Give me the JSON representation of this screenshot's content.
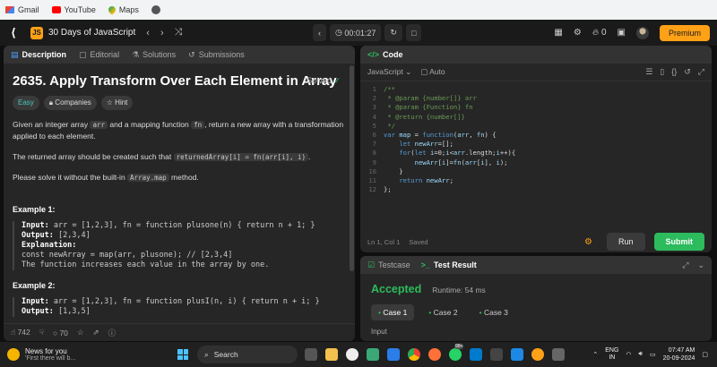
{
  "bookmarks": [
    {
      "label": "Gmail",
      "icon": "gmail-icon"
    },
    {
      "label": "YouTube",
      "icon": "youtube-icon"
    },
    {
      "label": "Maps",
      "icon": "maps-icon"
    }
  ],
  "nav": {
    "study_plan_title": "30 Days of JavaScript",
    "timer": "00:01:27",
    "streak_count": "0",
    "premium_label": "Premium"
  },
  "left_tabs": [
    {
      "label": "Description",
      "active": true
    },
    {
      "label": "Editorial",
      "active": false
    },
    {
      "label": "Solutions",
      "active": false
    },
    {
      "label": "Submissions",
      "active": false
    }
  ],
  "problem": {
    "title": "2635. Apply Transform Over Each Element in Array",
    "solved_label": "Solved",
    "difficulty": "Easy",
    "companies_label": "Companies",
    "hint_label": "Hint",
    "p1_a": "Given an integer array ",
    "p1_code1": "arr",
    "p1_b": " and a mapping function ",
    "p1_code2": "fn",
    "p1_c": ", return a new array with a transformation applied to each element.",
    "p2_a": "The returned array should be created such that ",
    "p2_code": "returnedArray[i] = fn(arr[i], i)",
    "p2_b": ".",
    "p3_a": "Please solve it without the built-in ",
    "p3_code": "Array.map",
    "p3_b": " method.",
    "ex1_title": "Example 1:",
    "ex1_input_label": "Input:",
    "ex1_input": "arr = [1,2,3], fn = function plusone(n) { return n + 1; }",
    "ex1_output_label": "Output:",
    "ex1_output": "[2,3,4]",
    "ex1_expl_label": "Explanation:",
    "ex1_expl_1": "const newArray = map(arr, plusone); // [2,3,4]",
    "ex1_expl_2": "The function increases each value in the array by one.",
    "ex2_title": "Example 2:",
    "ex2_input_label": "Input:",
    "ex2_input": "arr = [1,2,3], fn = function plusI(n, i) { return n + i; }",
    "ex2_output_label": "Output:",
    "ex2_output": "[1,3,5]"
  },
  "left_footer": {
    "likes": "742",
    "comments": "70"
  },
  "code_panel": {
    "title": "Code",
    "language": "JavaScript",
    "mode": "Auto",
    "cursor": "Ln 1, Col 1",
    "saved": "Saved",
    "run_label": "Run",
    "submit_label": "Submit"
  },
  "code_lines": [
    "/**",
    " * @param {number[]} arr",
    " * @param {Function} fn",
    " * @return {number[]}",
    " */",
    "var map = function(arr, fn) {",
    "    let newArr=[];",
    "    for(let i=0;i<arr.length;i++){",
    "        newArr[i]=fn(arr[i], i);",
    "    }",
    "    return newArr;",
    "};"
  ],
  "result_panel": {
    "testcase_tab": "Testcase",
    "result_tab": "Test Result",
    "status": "Accepted",
    "runtime": "Runtime: 54 ms",
    "cases": [
      "Case 1",
      "Case 2",
      "Case 3"
    ],
    "input_label": "Input"
  },
  "taskbar": {
    "news_title": "News for you",
    "news_sub": "'First there will b...",
    "search_label": "Search",
    "lang_1": "ENG",
    "lang_2": "IN",
    "time": "07:47 AM",
    "date": "20-09-2024",
    "badge": "99+"
  },
  "colors": {
    "accent_orange": "#ffa116",
    "accepted_green": "#2cbb5d",
    "panel_bg": "#262626",
    "page_bg": "#0f0f0f"
  }
}
